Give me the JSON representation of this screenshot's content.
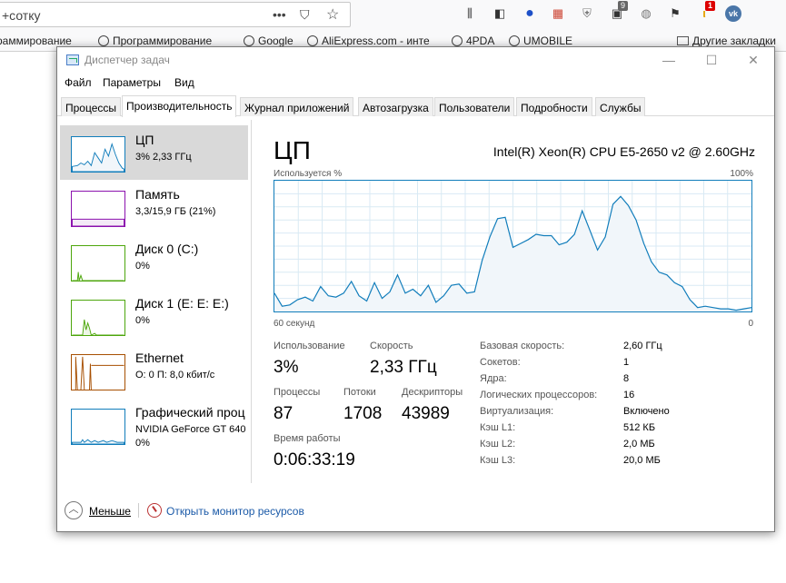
{
  "browser": {
    "url_text": "+сотку",
    "icons": [
      "ellipsis-icon",
      "pocket-icon",
      "star-icon",
      "library-icon",
      "sidebar-icon",
      "blue-dot-icon",
      "colorful-extension-icon",
      "shield-question-icon",
      "badge-extension-icon",
      "globe-icon",
      "flag-icon",
      "notification-icon",
      "vk-icon"
    ],
    "badge_9": "9",
    "badge_1": "1",
    "bookmarks": [
      "раммирование",
      "Программирование",
      "Google",
      "AliExpress.com - инте",
      "4PDA",
      "UMOBILE",
      "Другие закладки"
    ]
  },
  "window": {
    "title": "Диспетчер задач",
    "minimize": "—",
    "maximize": "☐",
    "close": "✕"
  },
  "menu": [
    "Файл",
    "Параметры",
    "Вид"
  ],
  "tabs": [
    "Процессы",
    "Производительность",
    "Журнал приложений",
    "Автозагрузка",
    "Пользователи",
    "Подробности",
    "Службы"
  ],
  "sidebar": [
    {
      "title": "ЦП",
      "sub1": "3%  2,33 ГГц",
      "sub2": "",
      "color": "#117dbb"
    },
    {
      "title": "Память",
      "sub1": "3,3/15,9 ГБ (21%)",
      "sub2": "",
      "color": "#8b12ae"
    },
    {
      "title": "Диск 0 (C:)",
      "sub1": "0%",
      "sub2": "",
      "color": "#4da60c"
    },
    {
      "title": "Диск 1 (E: E: E:)",
      "sub1": "0%",
      "sub2": "",
      "color": "#4da60c"
    },
    {
      "title": "Ethernet",
      "sub1": "О: 0 П: 8,0 кбит/с",
      "sub2": "",
      "color": "#a74f01"
    },
    {
      "title": "Графический проц",
      "sub1": "NVIDIA GeForce GT 640",
      "sub2": "0%",
      "color": "#117dbb"
    }
  ],
  "main": {
    "title": "ЦП",
    "cpu_name": "Intel(R) Xeon(R) CPU E5-2650 v2 @ 2.60GHz",
    "graph_label": "Используется %",
    "graph_max": "100%",
    "graph_left": "60 секунд",
    "graph_right": "0",
    "usage_label": "Использование",
    "usage_value": "3%",
    "speed_label": "Скорость",
    "speed_value": "2,33 ГГц",
    "processes_label": "Процессы",
    "processes_value": "87",
    "threads_label": "Потоки",
    "threads_value": "1708",
    "handles_label": "Дескрипторы",
    "handles_value": "43989",
    "uptime_label": "Время работы",
    "uptime_value": "0:06:33:19",
    "specs": [
      {
        "k": "Базовая скорость:",
        "v": "2,60 ГГц"
      },
      {
        "k": "Сокетов:",
        "v": "1"
      },
      {
        "k": "Ядра:",
        "v": "8"
      },
      {
        "k": "Логических процессоров:",
        "v": "16"
      },
      {
        "k": "Виртуализация:",
        "v": "Включено"
      },
      {
        "k": "Кэш L1:",
        "v": "512 КБ"
      },
      {
        "k": "Кэш L2:",
        "v": "2,0 МБ"
      },
      {
        "k": "Кэш L3:",
        "v": "20,0 МБ"
      }
    ],
    "cpu_history_percent": [
      14,
      4,
      5,
      9,
      11,
      8,
      19,
      12,
      11,
      14,
      23,
      12,
      8,
      22,
      10,
      15,
      28,
      14,
      17,
      12,
      20,
      7,
      12,
      20,
      21,
      14,
      15,
      39,
      57,
      71,
      72,
      49,
      52,
      55,
      59,
      58,
      58,
      51,
      53,
      59,
      77,
      62,
      47,
      57,
      82,
      88,
      81,
      70,
      52,
      38,
      30,
      28,
      22,
      19,
      9,
      3,
      4,
      3,
      2,
      2,
      1,
      2,
      3
    ]
  },
  "footer": {
    "fewer": "Меньше",
    "resmon": "Открыть монитор ресурсов"
  }
}
